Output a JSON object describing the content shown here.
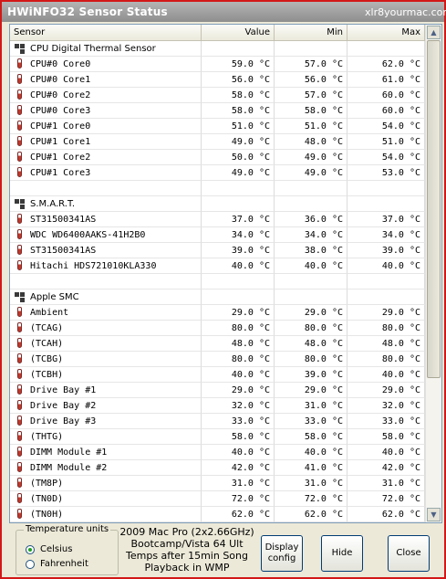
{
  "window": {
    "title": "HWiNFO32 Sensor Status",
    "watermark": "xlr8yourmac.com"
  },
  "columns": {
    "sensor": "Sensor",
    "value": "Value",
    "min": "Min",
    "max": "Max"
  },
  "rows": [
    {
      "kind": "group",
      "name": "CPU Digital Thermal Sensor",
      "icon": "chip-icon"
    },
    {
      "kind": "sensor",
      "name": "CPU#0 Core0",
      "value": "59.0 °C",
      "min": "57.0 °C",
      "max": "62.0 °C"
    },
    {
      "kind": "sensor",
      "name": "CPU#0 Core1",
      "value": "56.0 °C",
      "min": "56.0 °C",
      "max": "61.0 °C"
    },
    {
      "kind": "sensor",
      "name": "CPU#0 Core2",
      "value": "58.0 °C",
      "min": "57.0 °C",
      "max": "60.0 °C"
    },
    {
      "kind": "sensor",
      "name": "CPU#0 Core3",
      "value": "58.0 °C",
      "min": "58.0 °C",
      "max": "60.0 °C"
    },
    {
      "kind": "sensor",
      "name": "CPU#1 Core0",
      "value": "51.0 °C",
      "min": "51.0 °C",
      "max": "54.0 °C"
    },
    {
      "kind": "sensor",
      "name": "CPU#1 Core1",
      "value": "49.0 °C",
      "min": "48.0 °C",
      "max": "51.0 °C"
    },
    {
      "kind": "sensor",
      "name": "CPU#1 Core2",
      "value": "50.0 °C",
      "min": "49.0 °C",
      "max": "54.0 °C"
    },
    {
      "kind": "sensor",
      "name": "CPU#1 Core3",
      "value": "49.0 °C",
      "min": "49.0 °C",
      "max": "53.0 °C"
    },
    {
      "kind": "blank"
    },
    {
      "kind": "group",
      "name": "S.M.A.R.T.",
      "icon": "chip-icon"
    },
    {
      "kind": "sensor",
      "name": "ST31500341AS",
      "value": "37.0 °C",
      "min": "36.0 °C",
      "max": "37.0 °C"
    },
    {
      "kind": "sensor",
      "name": "WDC WD6400AAKS-41H2B0",
      "value": "34.0 °C",
      "min": "34.0 °C",
      "max": "34.0 °C"
    },
    {
      "kind": "sensor",
      "name": "ST31500341AS",
      "value": "39.0 °C",
      "min": "38.0 °C",
      "max": "39.0 °C"
    },
    {
      "kind": "sensor",
      "name": "Hitachi HDS721010KLA330",
      "value": "40.0 °C",
      "min": "40.0 °C",
      "max": "40.0 °C"
    },
    {
      "kind": "blank"
    },
    {
      "kind": "group",
      "name": "Apple SMC",
      "icon": "chip-icon"
    },
    {
      "kind": "sensor",
      "name": "Ambient",
      "value": "29.0 °C",
      "min": "29.0 °C",
      "max": "29.0 °C"
    },
    {
      "kind": "sensor",
      "name": "(TCAG)",
      "value": "80.0 °C",
      "min": "80.0 °C",
      "max": "80.0 °C"
    },
    {
      "kind": "sensor",
      "name": "(TCAH)",
      "value": "48.0 °C",
      "min": "48.0 °C",
      "max": "48.0 °C"
    },
    {
      "kind": "sensor",
      "name": "(TCBG)",
      "value": "80.0 °C",
      "min": "80.0 °C",
      "max": "80.0 °C"
    },
    {
      "kind": "sensor",
      "name": "(TCBH)",
      "value": "40.0 °C",
      "min": "39.0 °C",
      "max": "40.0 °C"
    },
    {
      "kind": "sensor",
      "name": "Drive Bay #1",
      "value": "29.0 °C",
      "min": "29.0 °C",
      "max": "29.0 °C"
    },
    {
      "kind": "sensor",
      "name": "Drive Bay #2",
      "value": "32.0 °C",
      "min": "31.0 °C",
      "max": "32.0 °C"
    },
    {
      "kind": "sensor",
      "name": "Drive Bay #3",
      "value": "33.0 °C",
      "min": "33.0 °C",
      "max": "33.0 °C"
    },
    {
      "kind": "sensor",
      "name": "(THTG)",
      "value": "58.0 °C",
      "min": "58.0 °C",
      "max": "58.0 °C"
    },
    {
      "kind": "sensor",
      "name": "DIMM Module #1",
      "value": "40.0 °C",
      "min": "40.0 °C",
      "max": "40.0 °C"
    },
    {
      "kind": "sensor",
      "name": "DIMM Module #2",
      "value": "42.0 °C",
      "min": "41.0 °C",
      "max": "42.0 °C"
    },
    {
      "kind": "sensor",
      "name": "(TM8P)",
      "value": "31.0 °C",
      "min": "31.0 °C",
      "max": "31.0 °C"
    },
    {
      "kind": "sensor",
      "name": "(TN0D)",
      "value": "72.0 °C",
      "min": "72.0 °C",
      "max": "72.0 °C"
    },
    {
      "kind": "sensor",
      "name": "(TN0H)",
      "value": "62.0 °C",
      "min": "62.0 °C",
      "max": "62.0 °C"
    }
  ],
  "temperature_units": {
    "legend": "Temperature units",
    "celsius": "Celsius",
    "fahrenheit": "Fahrenheit",
    "selected": "Celsius"
  },
  "caption": {
    "line1": "2009 Mac Pro (2x2.66GHz)",
    "line2": "Bootcamp/Vista 64 Ult",
    "line3": "Temps after 15min Song",
    "line4": "Playback in WMP"
  },
  "buttons": {
    "display_config_line1": "Display",
    "display_config_line2": "config",
    "hide": "Hide",
    "close": "Close"
  },
  "scrollbar": {
    "up": "▲",
    "down": "▼"
  },
  "colors": {
    "frame_border": "#d21818",
    "thermometer": "#c0392b",
    "radio_selected": "#21a121"
  }
}
